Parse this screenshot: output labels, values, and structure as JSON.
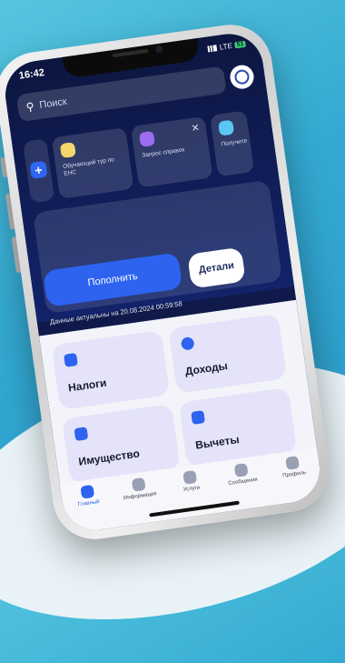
{
  "status": {
    "time": "16:42",
    "network": "LTE",
    "battery": "51"
  },
  "search": {
    "placeholder": "Поиск",
    "icon": "search-icon"
  },
  "stories": [
    {
      "text": "Обучающий тур по ЕНС",
      "icon": "lightbulb-icon",
      "color": "#f5d66b"
    },
    {
      "text": "Запрос справок",
      "icon": "document-icon",
      "color": "#9b6cf0"
    },
    {
      "text": "Получите",
      "icon": "cube-icon",
      "color": "#5ac7f2"
    }
  ],
  "balance": {
    "topup_label": "Пополнить",
    "details_label": "Детали",
    "updated": "Данные актуальны на 20.08.2024 00:59:58"
  },
  "tiles": [
    {
      "label": "Налоги",
      "icon": "document-icon",
      "color": "#2d63ef"
    },
    {
      "label": "Доходы",
      "icon": "ruble-icon",
      "color": "#2d63ef"
    },
    {
      "label": "Имущество",
      "icon": "house-icon",
      "color": "#2d63ef"
    },
    {
      "label": "Вычеты",
      "icon": "document-icon",
      "color": "#2d63ef"
    }
  ],
  "tabs": [
    {
      "label": "Главный",
      "icon": "home-icon"
    },
    {
      "label": "Информация",
      "icon": "info-icon"
    },
    {
      "label": "Услуги",
      "icon": "grid-icon"
    },
    {
      "label": "Сообщения",
      "icon": "chat-icon"
    },
    {
      "label": "Профиль",
      "icon": "user-icon"
    }
  ],
  "colors": {
    "accent": "#2d63ef",
    "header_bg": "#0f1a4a",
    "tile_bg": "#e4e3fa"
  }
}
